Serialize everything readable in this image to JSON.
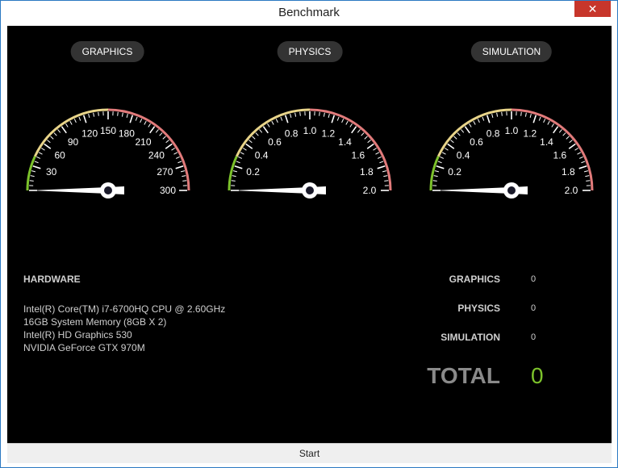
{
  "window": {
    "title": "Benchmark",
    "close_label": "✕"
  },
  "gauges": [
    {
      "label": "GRAPHICS",
      "ticks": [
        "30",
        "60",
        "90",
        "120",
        "150",
        "180",
        "210",
        "240",
        "270",
        "300"
      ],
      "value": 0
    },
    {
      "label": "PHYSICS",
      "ticks": [
        "0.2",
        "0.4",
        "0.6",
        "0.8",
        "1.0",
        "1.2",
        "1.4",
        "1.6",
        "1.8",
        "2.0"
      ],
      "value": 0
    },
    {
      "label": "SIMULATION",
      "ticks": [
        "0.2",
        "0.4",
        "0.6",
        "0.8",
        "1.0",
        "1.2",
        "1.4",
        "1.6",
        "1.8",
        "2.0"
      ],
      "value": 0
    }
  ],
  "hardware": {
    "title": "HARDWARE",
    "items": [
      "Intel(R) Core(TM) i7-6700HQ CPU @ 2.60GHz",
      "16GB System Memory (8GB X 2)",
      "Intel(R) HD Graphics 530",
      "NVIDIA GeForce GTX 970M"
    ]
  },
  "scores": {
    "graphics_label": "GRAPHICS",
    "graphics_value": "0",
    "physics_label": "PHYSICS",
    "physics_value": "0",
    "simulation_label": "SIMULATION",
    "simulation_value": "0",
    "total_label": "TOTAL",
    "total_value": "0"
  },
  "start_label": "Start",
  "colors": {
    "green": "#7cc22b",
    "yellow": "#e9d58a",
    "red": "#e27b7b",
    "pill_bg": "#333333"
  }
}
